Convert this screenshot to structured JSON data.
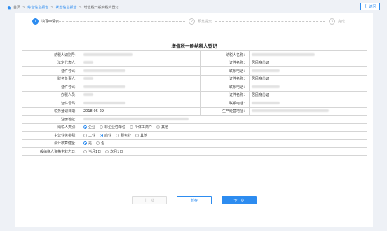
{
  "breadcrumb": {
    "home": "首页",
    "items": [
      "综合信息报告",
      "状态信息报告",
      "增值税一般纳税人登记"
    ]
  },
  "back_button": "返回",
  "steps": [
    {
      "num": "1",
      "label": "填写申请表",
      "state": "active"
    },
    {
      "num": "2",
      "label": "预览提交",
      "state": "todo"
    },
    {
      "num": "3",
      "label": "完成",
      "state": "todo"
    }
  ],
  "form_title": "增值税一般纳税人登记",
  "fields": {
    "taxpayer_id": {
      "label": "纳税人识别号：",
      "value": ""
    },
    "taxpayer_name": {
      "label": "纳税人名称：",
      "value": ""
    },
    "legal_rep": {
      "label": "法定代表人：",
      "value": ""
    },
    "legal_cert_name": {
      "label": "证件名称：",
      "value": "居民身份证"
    },
    "legal_cert_no": {
      "label": "证件号码：",
      "value": ""
    },
    "legal_phone": {
      "label": "联系电话：",
      "value": ""
    },
    "finance_head": {
      "label": "财务负责人：",
      "value": ""
    },
    "finance_cert_name": {
      "label": "证件名称：",
      "value": "居民身份证"
    },
    "finance_cert_no": {
      "label": "证件号码：",
      "value": ""
    },
    "finance_phone": {
      "label": "联系电话：",
      "value": ""
    },
    "tax_officer": {
      "label": "办税人员：",
      "value": ""
    },
    "officer_cert_name": {
      "label": "证件名称：",
      "value": "居民身份证"
    },
    "officer_cert_no": {
      "label": "证件号码：",
      "value": ""
    },
    "officer_phone": {
      "label": "联系电话：",
      "value": ""
    },
    "reg_date": {
      "label": "税务登记日期：",
      "value": "2018-05-29"
    },
    "biz_address": {
      "label": "生产经营地址：",
      "value": ""
    },
    "reg_address": {
      "label": "注册地址：",
      "value": ""
    }
  },
  "taxpayer_category": {
    "label": "纳税人类别：",
    "options": [
      "企业",
      "非企业性单位",
      "个体工商户",
      "其他"
    ],
    "selected": 0
  },
  "main_business": {
    "label": "主营业务类别：",
    "options": [
      "工业",
      "商业",
      "服务业",
      "其他"
    ],
    "selected": 1
  },
  "accounting": {
    "label": "会计核算健全：",
    "options": [
      "是",
      "否"
    ],
    "selected": 0
  },
  "effective_date": {
    "label": "一般纳税人资格生效之日：",
    "options": [
      "当月1日",
      "次月1日"
    ],
    "selected": -1
  },
  "buttons": {
    "prev": "上一步",
    "save": "暂存",
    "next": "下一步"
  },
  "colors": {
    "accent": "#2d8cf0",
    "background": "#eef1f6"
  }
}
